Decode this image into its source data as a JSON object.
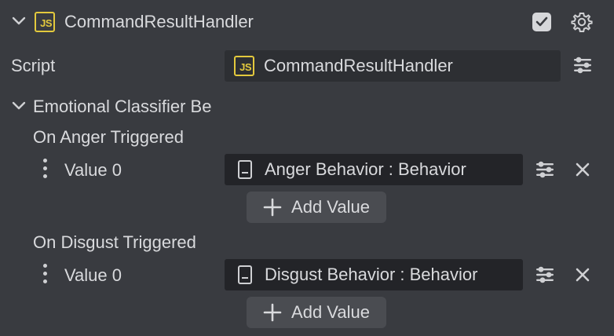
{
  "component": {
    "title": "CommandResultHandler",
    "enabled": true,
    "icons": {
      "collapse": "chevron-down-icon",
      "type": "js-file-icon",
      "settings": "gear-icon"
    }
  },
  "script_row": {
    "label": "Script",
    "value": "CommandResultHandler",
    "value_icon": "js-file-icon",
    "options_icon": "sliders-icon"
  },
  "section": {
    "title": "Emotional Classifier Be",
    "events": [
      {
        "title": "On Anger Triggered",
        "entries": [
          {
            "label": "Value 0",
            "value": "Anger Behavior : Behavior"
          }
        ],
        "add_label": "Add Value"
      },
      {
        "title": "On Disgust Triggered",
        "entries": [
          {
            "label": "Value 0",
            "value": "Disgust Behavior : Behavior"
          }
        ],
        "add_label": "Add Value"
      }
    ]
  },
  "colors": {
    "panel_bg": "#393b40",
    "field_bg": "#232428",
    "js_accent": "#e3c93d",
    "text": "#d9dadd"
  }
}
